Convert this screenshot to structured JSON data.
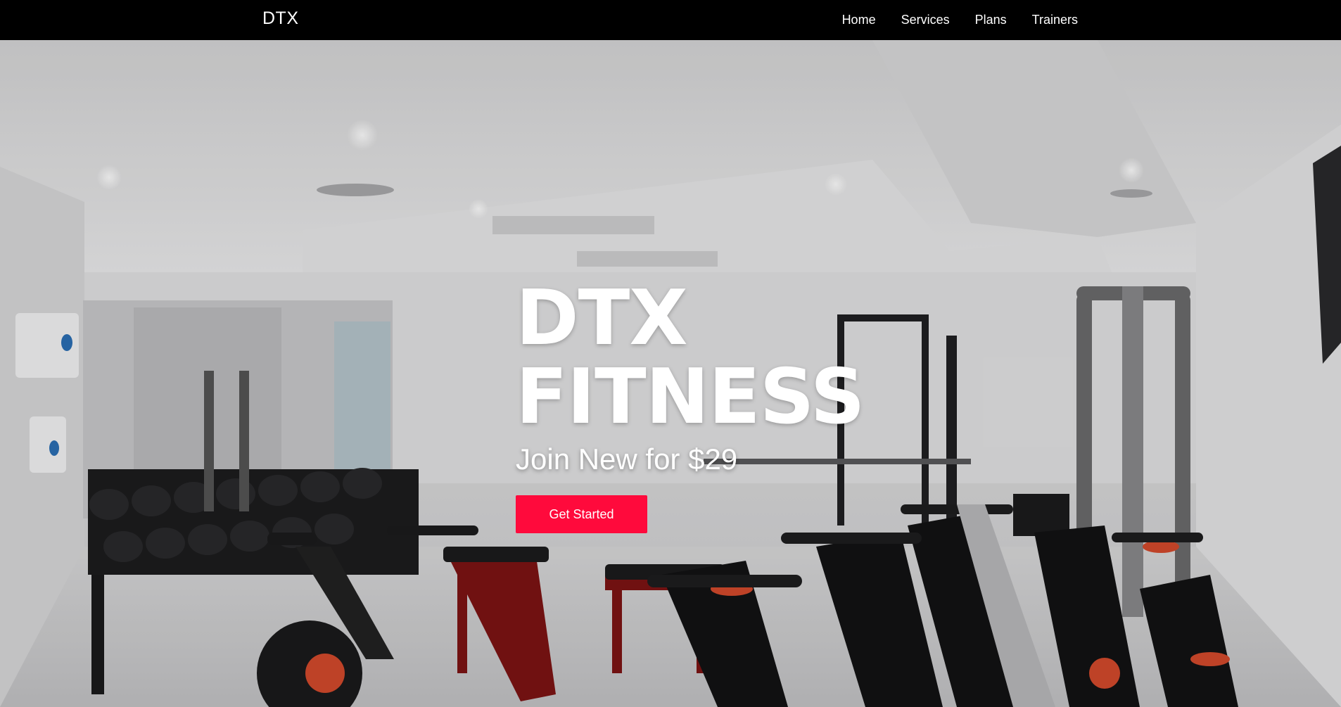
{
  "navbar": {
    "brand": "DTX",
    "links": [
      "Home",
      "Services",
      "Plans",
      "Trainers"
    ]
  },
  "hero": {
    "title_line1": "DTX",
    "title_line2": "FITNESS",
    "subtitle": "Join New for $29",
    "cta_label": "Get Started",
    "background": "gym-interior-photo"
  },
  "colors": {
    "navbar_bg": "#000000",
    "accent": "#ff0a3c",
    "text": "#ffffff"
  }
}
